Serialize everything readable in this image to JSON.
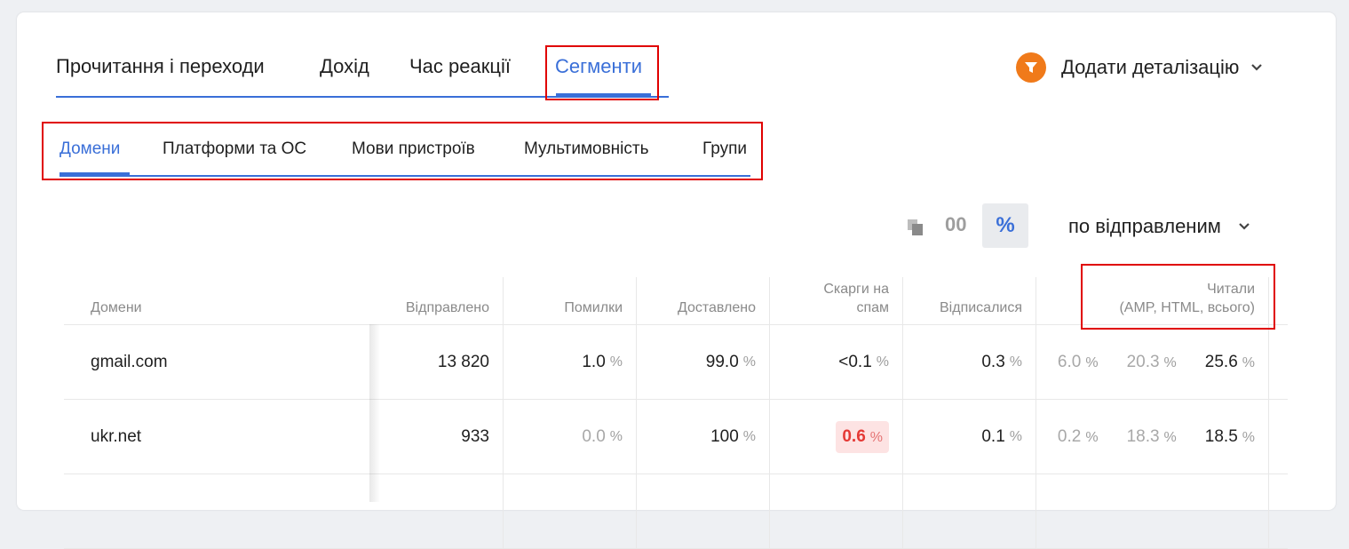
{
  "main_tabs": [
    {
      "label": "Прочитання і переходи",
      "active": false
    },
    {
      "label": "Дохід",
      "active": false
    },
    {
      "label": "Час реакції",
      "active": false
    },
    {
      "label": "Сегменти",
      "active": true
    }
  ],
  "breakdown": {
    "label": "Додати деталізацію",
    "icon": "funnel-icon",
    "icon_color": "#f07a1a"
  },
  "sub_tabs": [
    {
      "label": "Домени",
      "active": true
    },
    {
      "label": "Платформи та ОС",
      "active": false
    },
    {
      "label": "Мови пристроїв",
      "active": false
    },
    {
      "label": "Мультимовність",
      "active": false
    },
    {
      "label": "Групи",
      "active": false
    }
  ],
  "view_controls": {
    "absolute_label": "00",
    "percent_label": "%",
    "percent_active": true,
    "by_select_label": "по відправленим"
  },
  "table": {
    "headers": {
      "domain": "Домени",
      "sent": "Відправлено",
      "errors": "Помилки",
      "delivered": "Доставлено",
      "spam_line1": "Скарги на",
      "spam_line2": "спам",
      "unsub": "Відписалися",
      "read_line1": "Читали",
      "read_line2": "(AMP, HTML, всього)"
    },
    "percent_sign": "%",
    "rows": [
      {
        "domain": "gmail.com",
        "sent": "13 820",
        "errors": "1.0",
        "delivered": "99.0",
        "spam": "<0.1",
        "unsub": "0.3",
        "read_amp": "6.0",
        "read_html": "20.3",
        "read_total": "25.6"
      },
      {
        "domain": "ukr.net",
        "sent": "933",
        "errors": "0.0",
        "delivered": "100",
        "spam": "0.6",
        "unsub": "0.1",
        "read_amp": "0.2",
        "read_html": "18.3",
        "read_total": "18.5"
      }
    ]
  },
  "colors": {
    "accent": "#3a6fd8",
    "highlight_border": "#e00000",
    "alert_bg": "#fde3e3",
    "alert_text": "#e53935"
  }
}
